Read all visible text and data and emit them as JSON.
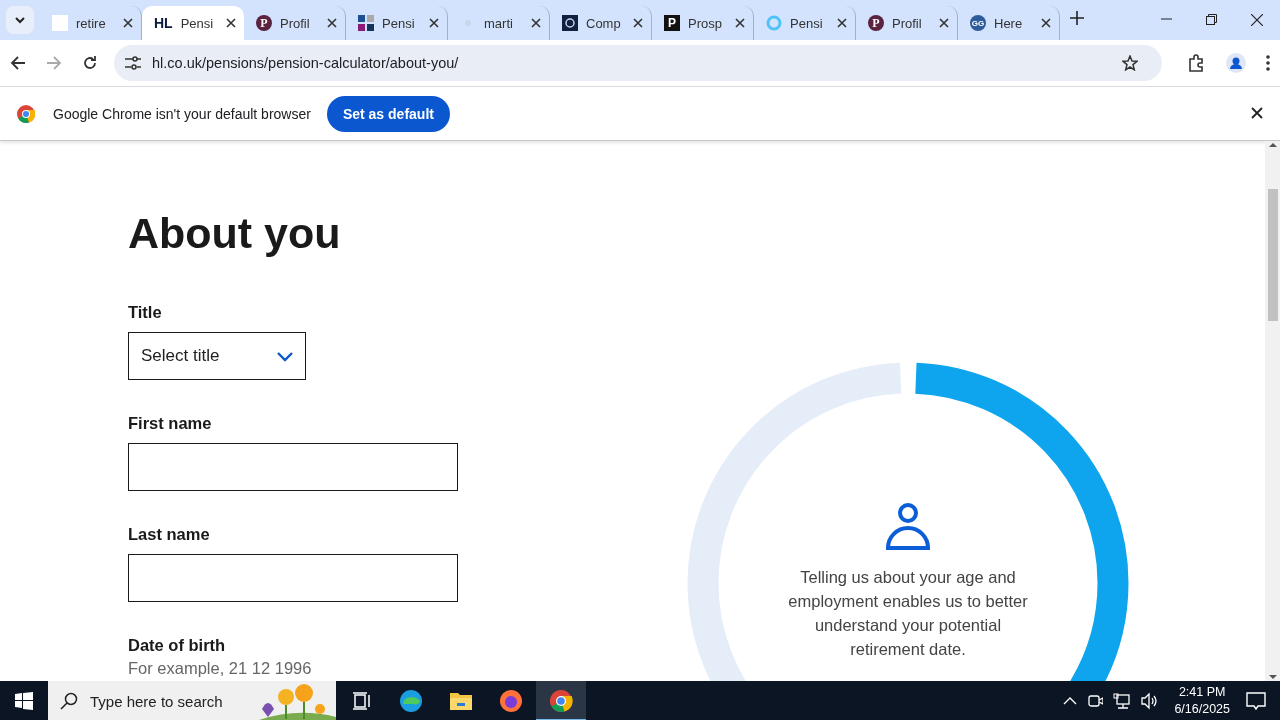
{
  "browser": {
    "tabs": [
      {
        "kind": "blank",
        "title": "retire",
        "selected": false
      },
      {
        "kind": "text",
        "favicon_text": "HL",
        "title": "Pensi",
        "selected": true
      },
      {
        "kind": "circle-letter",
        "favicon_text": "P",
        "title": "Profil",
        "selected": false
      },
      {
        "kind": "grid",
        "title": "Pensi",
        "selected": false
      },
      {
        "kind": "faint",
        "title": "marti",
        "selected": false
      },
      {
        "kind": "navy",
        "title": "Comp",
        "selected": false
      },
      {
        "kind": "square-letter",
        "favicon_text": "P",
        "title": "Prosp",
        "selected": false
      },
      {
        "kind": "ring",
        "title": "Pensi",
        "selected": false
      },
      {
        "kind": "circle-letter",
        "favicon_text": "P",
        "title": "Profil",
        "selected": false
      },
      {
        "kind": "circle-text",
        "favicon_text": "GG",
        "title": "Here",
        "selected": false
      }
    ],
    "address": "hl.co.uk/pensions/pension-calculator/about-you/",
    "infobar": {
      "message": "Google Chrome isn't your default browser",
      "button": "Set as default"
    }
  },
  "page": {
    "heading": "About you",
    "fields": [
      {
        "kind": "select",
        "label": "Title",
        "value": "Select title"
      },
      {
        "kind": "text",
        "label": "First name"
      },
      {
        "kind": "text",
        "label": "Last name"
      },
      {
        "kind": "date",
        "label": "Date of birth",
        "hint": "For example, 21 12 1996"
      }
    ],
    "progress": {
      "text": "Telling us about your age and employment enables us to better understand your potential retirement date."
    }
  },
  "taskbar": {
    "search_placeholder": "Type here to search",
    "time": "2:41 PM",
    "date": "6/16/2025"
  }
}
